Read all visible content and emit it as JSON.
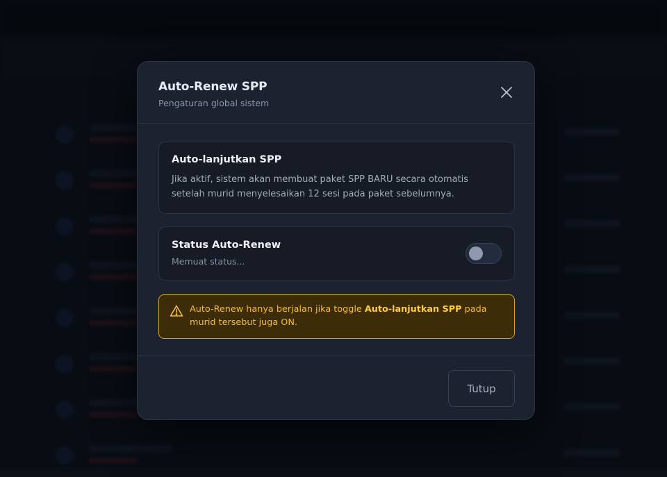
{
  "modal": {
    "title": "Auto-Renew SPP",
    "subtitle": "Pengaturan global sistem",
    "close_icon": "close-icon"
  },
  "info_card": {
    "heading": "Auto-lanjutkan SPP",
    "description": "Jika aktif, sistem akan membuat paket SPP BARU secara otomatis setelah murid menyelesaikan 12 sesi pada paket sebelumnya."
  },
  "status_card": {
    "heading": "Status Auto-Renew",
    "status_text": "Memuat status...",
    "toggle_on": false
  },
  "warning": {
    "icon": "warning-triangle-icon",
    "text_before": "Auto-Renew hanya berjalan jika toggle ",
    "text_bold": "Auto-lanjutkan SPP",
    "text_after": " pada murid tersebut juga ON."
  },
  "footer": {
    "close_label": "Tutup"
  },
  "colors": {
    "modal_bg": "#1c2230",
    "card_bg": "#161b26",
    "warning_bg": "#3d2c08",
    "warning_border": "#d7a12a",
    "warning_text": "#f4be3c"
  }
}
